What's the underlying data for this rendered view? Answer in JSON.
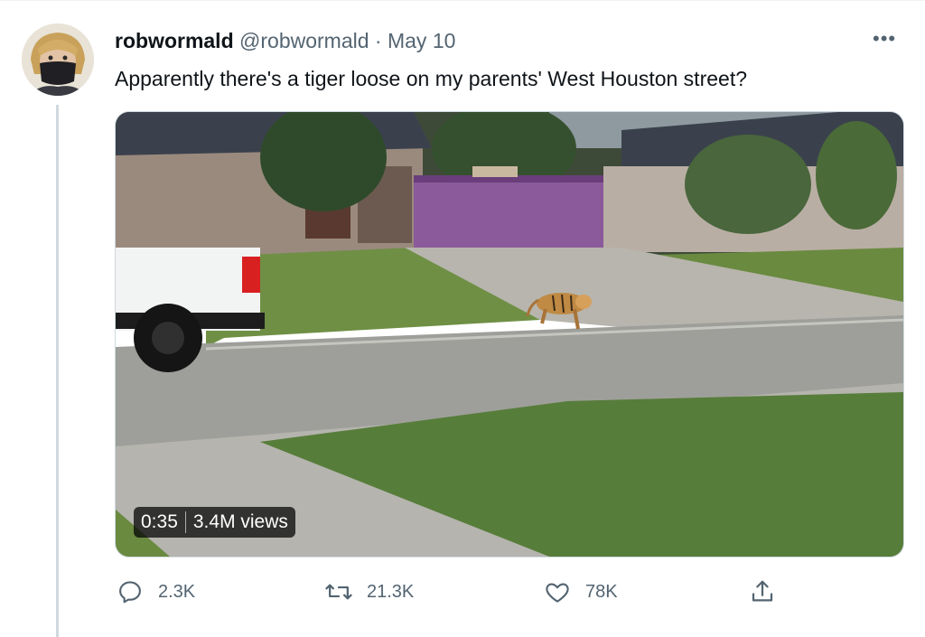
{
  "tweet": {
    "display_name": "robwormald",
    "handle": "@robwormald",
    "separator": "·",
    "date": "May 10",
    "more_label": "•••",
    "text": "Apparently there's a tiger loose on my parents' West Houston street?"
  },
  "media": {
    "duration": "0:35",
    "views": "3.4M views"
  },
  "actions": {
    "reply_count": "2.3K",
    "retweet_count": "21.3K",
    "like_count": "78K"
  },
  "icons": {
    "reply": "reply-icon",
    "retweet": "retweet-icon",
    "like": "heart-icon",
    "share": "share-icon"
  },
  "colors": {
    "text_primary": "#0f1419",
    "text_secondary": "#536471",
    "border": "#cfd9de"
  }
}
